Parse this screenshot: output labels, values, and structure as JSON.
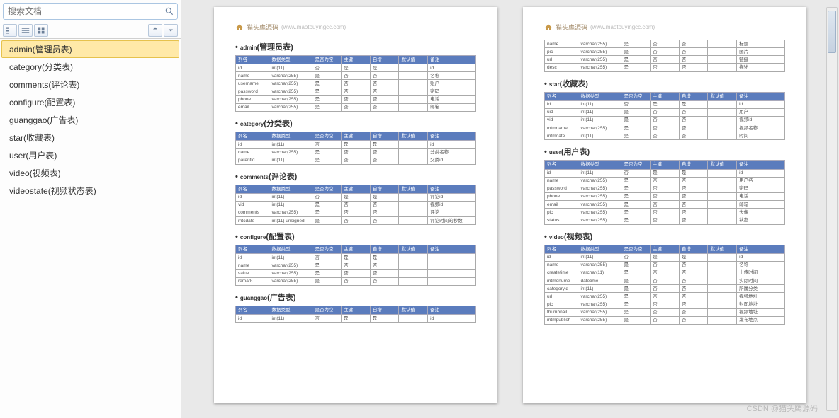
{
  "search": {
    "placeholder": "搜索文档"
  },
  "nav": {
    "items": [
      {
        "label": "admin(管理员表)",
        "active": true
      },
      {
        "label": "category(分类表)",
        "active": false
      },
      {
        "label": "comments(评论表)",
        "active": false
      },
      {
        "label": "configure(配置表)",
        "active": false
      },
      {
        "label": "guanggao(广告表)",
        "active": false
      },
      {
        "label": "star(收藏表)",
        "active": false
      },
      {
        "label": "user(用户表)",
        "active": false
      },
      {
        "label": "video(视频表)",
        "active": false
      },
      {
        "label": "videostate(视频状态表)",
        "active": false
      }
    ]
  },
  "doc": {
    "brand": "猫头鹰源码",
    "url": "(www.maotouyingcc.com)",
    "columns": [
      "列名",
      "数据类型",
      "是否为空",
      "主键",
      "自增",
      "默认值",
      "备注"
    ],
    "sections": [
      {
        "title": "admin(管理员表)",
        "page": 1,
        "rows": [
          [
            "id",
            "int(11)",
            "否",
            "是",
            "是",
            "",
            "id"
          ],
          [
            "name",
            "varchar(255)",
            "是",
            "否",
            "否",
            "",
            "名称"
          ],
          [
            "username",
            "varchar(255)",
            "是",
            "否",
            "否",
            "",
            "账户"
          ],
          [
            "password",
            "varchar(255)",
            "是",
            "否",
            "否",
            "",
            "密码"
          ],
          [
            "phone",
            "varchar(255)",
            "是",
            "否",
            "否",
            "",
            "电话"
          ],
          [
            "email",
            "varchar(255)",
            "是",
            "否",
            "否",
            "",
            "邮箱"
          ]
        ]
      },
      {
        "title": "category(分类表)",
        "page": 1,
        "rows": [
          [
            "id",
            "int(11)",
            "否",
            "是",
            "是",
            "",
            "id"
          ],
          [
            "name",
            "varchar(255)",
            "是",
            "否",
            "否",
            "",
            "分类名称"
          ],
          [
            "parentid",
            "int(11)",
            "是",
            "否",
            "否",
            "",
            "父类id"
          ]
        ]
      },
      {
        "title": "comments(评论表)",
        "page": 1,
        "rows": [
          [
            "id",
            "int(11)",
            "否",
            "是",
            "是",
            "",
            "评论id"
          ],
          [
            "vid",
            "int(11)",
            "是",
            "否",
            "否",
            "",
            "视频id"
          ],
          [
            "comments",
            "varchar(255)",
            "是",
            "否",
            "否",
            "",
            "评论"
          ],
          [
            "mtcdate",
            "int(11)  unsigned",
            "是",
            "否",
            "否",
            "",
            "评论时间的秒数"
          ]
        ]
      },
      {
        "title": "configure(配置表)",
        "page": 1,
        "rows": [
          [
            "id",
            "int(11)",
            "否",
            "是",
            "是",
            "",
            ""
          ],
          [
            "name",
            "varchar(255)",
            "是",
            "否",
            "否",
            "",
            ""
          ],
          [
            "value",
            "varchar(255)",
            "是",
            "否",
            "否",
            "",
            ""
          ],
          [
            "remark",
            "varchar(255)",
            "是",
            "否",
            "否",
            "",
            ""
          ]
        ]
      },
      {
        "title": "guanggao(广告表)",
        "page": 1,
        "rows": [
          [
            "id",
            "int(11)",
            "否",
            "是",
            "是",
            "",
            "id"
          ]
        ]
      },
      {
        "title": "_pre2",
        "page": 2,
        "pre": true,
        "rows": [
          [
            "name",
            "varchar(255)",
            "是",
            "否",
            "否",
            "",
            "标题"
          ],
          [
            "pic",
            "varchar(255)",
            "是",
            "否",
            "否",
            "",
            "图片"
          ],
          [
            "url",
            "varchar(255)",
            "是",
            "否",
            "否",
            "",
            "链接"
          ],
          [
            "desc",
            "varchar(255)",
            "是",
            "否",
            "否",
            "",
            "描述"
          ]
        ]
      },
      {
        "title": "star(收藏表)",
        "page": 2,
        "rows": [
          [
            "id",
            "int(11)",
            "否",
            "是",
            "是",
            "",
            "id"
          ],
          [
            "uid",
            "int(11)",
            "是",
            "否",
            "否",
            "",
            "用户"
          ],
          [
            "vid",
            "int(11)",
            "是",
            "否",
            "否",
            "",
            "视频id"
          ],
          [
            "mtmname",
            "varchar(255)",
            "是",
            "否",
            "否",
            "",
            "视频名称"
          ],
          [
            "mtmdate",
            "int(11)",
            "是",
            "否",
            "否",
            "",
            "时间"
          ]
        ]
      },
      {
        "title": "user(用户表)",
        "page": 2,
        "rows": [
          [
            "id",
            "int(11)",
            "否",
            "是",
            "是",
            "",
            "id"
          ],
          [
            "name",
            "varchar(255)",
            "是",
            "否",
            "否",
            "",
            "用户名"
          ],
          [
            "password",
            "varchar(255)",
            "是",
            "否",
            "否",
            "",
            "密码"
          ],
          [
            "phone",
            "varchar(255)",
            "是",
            "否",
            "否",
            "",
            "电话"
          ],
          [
            "email",
            "varchar(255)",
            "是",
            "否",
            "否",
            "",
            "邮箱"
          ],
          [
            "pic",
            "varchar(255)",
            "是",
            "否",
            "否",
            "",
            "头像"
          ],
          [
            "status",
            "varchar(255)",
            "是",
            "否",
            "否",
            "",
            "状态"
          ]
        ]
      },
      {
        "title": "video(视频表)",
        "page": 2,
        "rows": [
          [
            "id",
            "int(11)",
            "否",
            "是",
            "是",
            "",
            "id"
          ],
          [
            "name",
            "varchar(255)",
            "是",
            "否",
            "否",
            "",
            "名称"
          ],
          [
            "createtime",
            "varchar(11)",
            "是",
            "否",
            "否",
            "",
            "上传时间"
          ],
          [
            "mtmonume",
            "datetime",
            "是",
            "否",
            "否",
            "",
            "实际时间"
          ],
          [
            "categoryid",
            "int(11)",
            "是",
            "否",
            "否",
            "",
            "所属分类"
          ],
          [
            "url",
            "varchar(255)",
            "是",
            "否",
            "否",
            "",
            "视频地址"
          ],
          [
            "pic",
            "varchar(255)",
            "是",
            "否",
            "否",
            "",
            "封面地址"
          ],
          [
            "thumbnail",
            "varchar(255)",
            "是",
            "否",
            "否",
            "",
            "视频地址"
          ],
          [
            "mtmpublish",
            "varchar(255)",
            "是",
            "否",
            "否",
            "",
            "发布地点"
          ]
        ]
      }
    ]
  },
  "watermark": "CSDN @猫头鹰源码"
}
